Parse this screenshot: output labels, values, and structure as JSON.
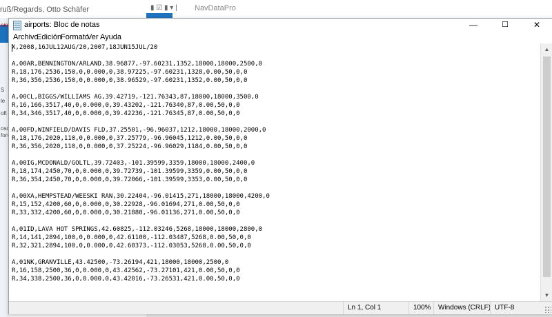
{
  "background": {
    "left_title": "ruß/Regards, Otto Schäfer",
    "left_fragments": [
      "S",
      "le",
      "oft",
      "osof",
      "forv",
      "ein"
    ],
    "right_title": "NavDataPro",
    "quick_access": "▮ ☑ ▮ ▾ |"
  },
  "window": {
    "title": "airports: Bloc de notas",
    "controls": {
      "minimize": "—",
      "maximize": "☐",
      "close": "✕"
    }
  },
  "menu": [
    "Archivo",
    "Edición",
    "Formato",
    "Ver",
    "Ayuda"
  ],
  "editor": {
    "lines": [
      "X,2008,16JUL12AUG/20,2007,18JUN15JUL/20",
      "",
      "A,00AR,BENNINGTON/ARLAND,38.96877,-97.60231,1352,18000,18000,2500,0",
      "R,18,176,2536,150,0,0.000,0,38.97225,-97.60231,1328,0.00,50,0,0",
      "R,36,356,2536,150,0,0.000,0,38.96529,-97.60231,1352,0.00,50,0,0",
      "",
      "A,00CL,BIGGS/WILLIAMS AG,39.42719,-121.76343,87,18000,18000,3500,0",
      "R,16,166,3517,40,0,0.000,0,39.43202,-121.76340,87,0.00,50,0,0",
      "R,34,346,3517,40,0,0.000,0,39.42236,-121.76345,87,0.00,50,0,0",
      "",
      "A,00FD,WINFIELD/DAVIS FLD,37.25501,-96.96037,1212,18000,18000,2000,0",
      "R,18,176,2020,110,0,0.000,0,37.25779,-96.96045,1212,0.00,50,0,0",
      "R,36,356,2020,110,0,0.000,0,37.25224,-96.96029,1184,0.00,50,0,0",
      "",
      "A,00IG,MCDONALD/GOLTL,39.72403,-101.39599,3359,18000,18000,2400,0",
      "R,18,174,2450,70,0,0.000,0,39.72739,-101.39599,3359,0.00,50,0,0",
      "R,36,354,2450,70,0,0.000,0,39.72066,-101.39599,3353,0.00,50,0,0",
      "",
      "A,00XA,HEMPSTEAD/WEESKI RAN,30.22404,-96.01415,271,18000,18000,4200,0",
      "R,15,152,4200,60,0,0.000,0,30.22928,-96.01694,271,0.00,50,0,0",
      "R,33,332,4200,60,0,0.000,0,30.21880,-96.01136,271,0.00,50,0,0",
      "",
      "A,01ID,LAVA HOT SPRINGS,42.60825,-112.03246,5268,18000,18000,2800,0",
      "R,14,141,2894,100,0,0.000,0,42.61100,-112.03487,5268,0.00,50,0,0",
      "R,32,321,2894,100,0,0.000,0,42.60373,-112.03053,5268,0.00,50,0,0",
      "",
      "A,01NK,GRANVILLE,43.42500,-73.26194,421,18000,18000,2500,0",
      "R,16,158,2500,36,0,0.000,0,43.42562,-73.27101,421,0.00,50,0,0",
      "R,34,338,2500,36,0,0.000,0,43.42016,-73.26531,421,0.00,50,0,0"
    ]
  },
  "status": {
    "position": "Ln 1, Col 1",
    "zoom": "100%",
    "line_ending": "Windows (CRLF)",
    "encoding": "UTF-8"
  },
  "scrollbar": {
    "up": "▲",
    "down": "▼"
  }
}
